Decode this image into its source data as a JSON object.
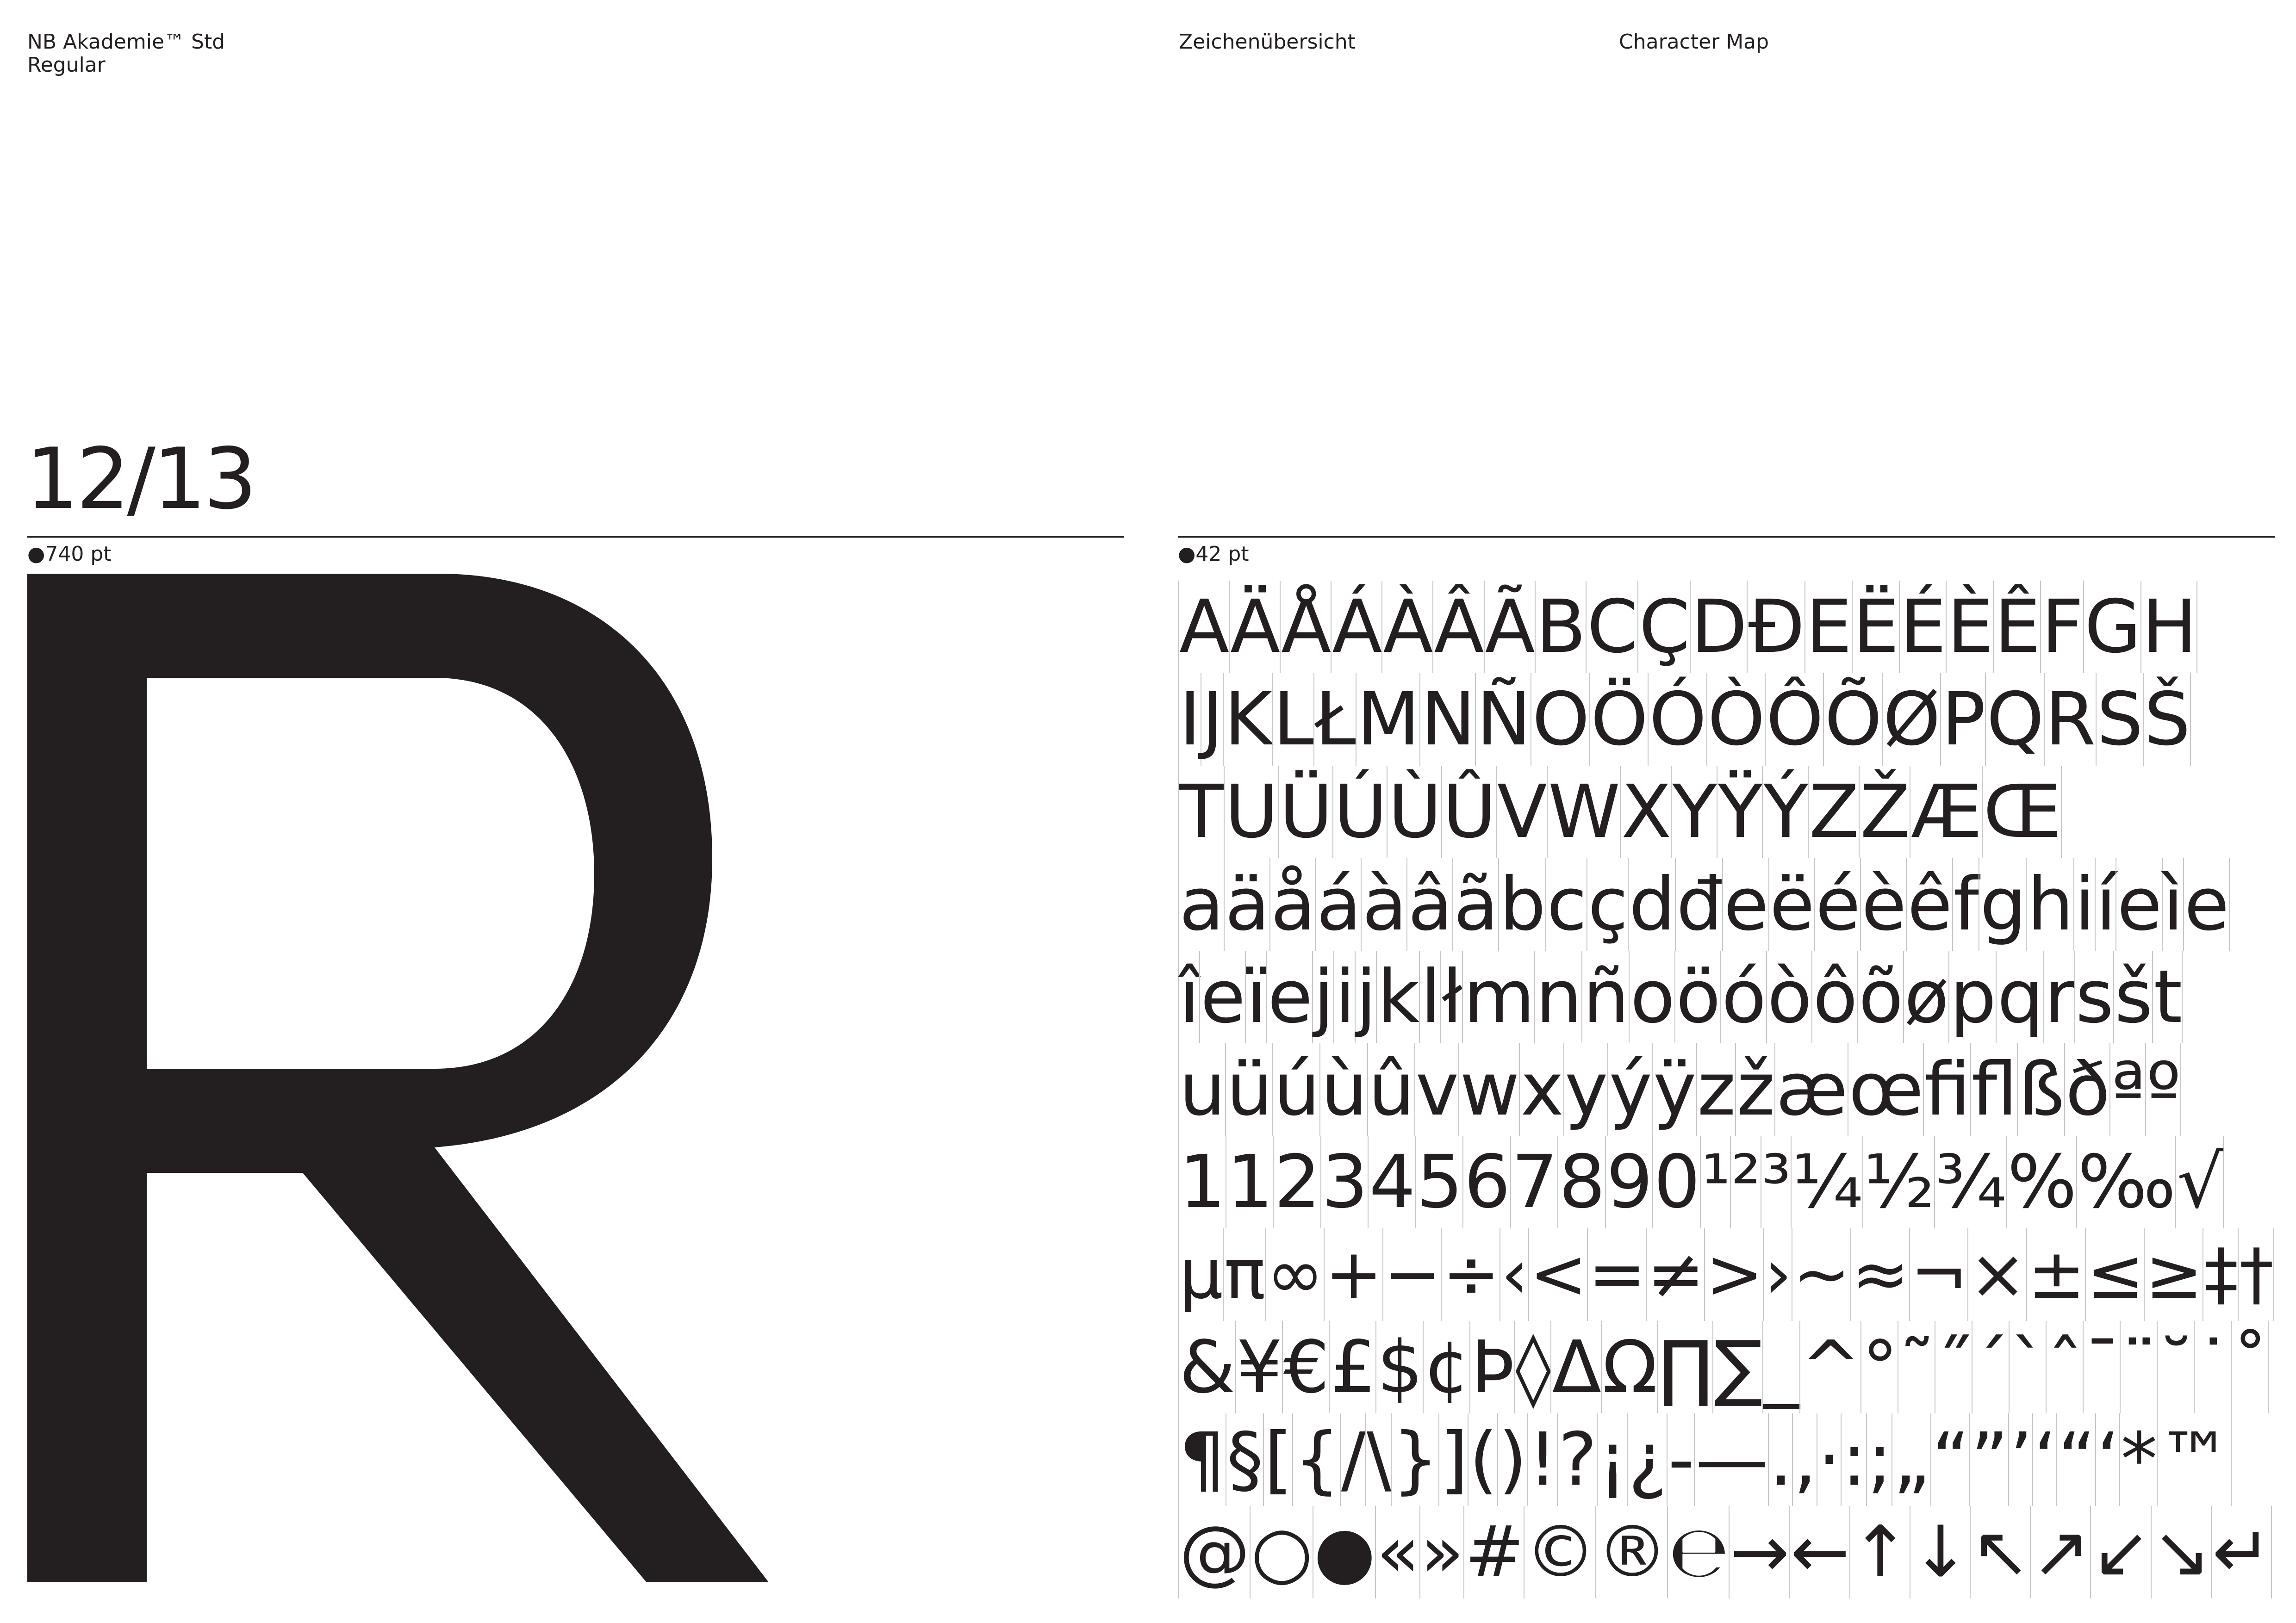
{
  "header": {
    "font_name": "NB Akademie™ Std\nRegular",
    "title_de": "Zeichenübersicht",
    "title_en": "Character Map"
  },
  "page_number": "12/13",
  "left_panel": {
    "size_label": "●740 pt",
    "glyph": "R"
  },
  "right_panel": {
    "size_label": "●42 pt",
    "rows": [
      [
        "A",
        "Ä",
        "Å",
        "Á",
        "À",
        "Â",
        "Ã",
        "B",
        "C",
        "Ç",
        "D",
        "Đ",
        "E",
        "Ë",
        "É",
        "È",
        "Ê",
        "F",
        "G",
        "H"
      ],
      [
        "I",
        "J",
        "K",
        "L",
        "Ł",
        "M",
        "N",
        "Ñ",
        "O",
        "Ö",
        "Ó",
        "Ò",
        "Ô",
        "Õ",
        "Ø",
        "P",
        "Q",
        "R",
        "S",
        "Š"
      ],
      [
        "T",
        "U",
        "Ü",
        "Ú",
        "Ù",
        "Û",
        "V",
        "W",
        "X",
        "Y",
        "Ÿ",
        "Ý",
        "Z",
        "Ž",
        "Æ",
        "Œ"
      ],
      [
        "a",
        "ä",
        "å",
        "á",
        "à",
        "â",
        "ã",
        "b",
        "c",
        "ç",
        "d",
        "đ",
        "e",
        "ë",
        "é",
        "è",
        "ê",
        "f",
        "g",
        "h",
        "i",
        "í",
        "e",
        "ì",
        "e"
      ],
      [
        "î",
        "e",
        "ï",
        "e",
        "j",
        "i",
        "j",
        "k",
        "l",
        "ł",
        "m",
        "n",
        "ñ",
        "o",
        "ö",
        "ó",
        "ò",
        "ô",
        "õ",
        "ø",
        "p",
        "q",
        "r",
        "s",
        "š",
        "t"
      ],
      [
        "u",
        "ü",
        "ú",
        "ù",
        "û",
        "v",
        "w",
        "x",
        "y",
        "ý",
        "ÿ",
        "z",
        "ž",
        "æ",
        "œ",
        "ﬁ",
        "ﬂ",
        "ß",
        "ð",
        "ª",
        "º"
      ],
      [
        "1",
        "1",
        "2",
        "3",
        "4",
        "5",
        "6",
        "7",
        "8",
        "9",
        "0",
        "¹",
        "²",
        "³",
        "¼",
        "½",
        "¾",
        "%",
        "‰",
        "√"
      ],
      [
        "µ",
        "π",
        "∞",
        "+",
        "−",
        "÷",
        "‹",
        "<",
        "=",
        "≠",
        ">",
        "›",
        "~",
        "≈",
        "¬",
        "×",
        "±",
        "≤",
        "≥",
        "‡",
        "†"
      ],
      [
        "&",
        "¥",
        "€",
        "£",
        "$",
        "¢",
        "Þ",
        "◊",
        "Δ",
        "Ω",
        "∏",
        "∑",
        "_",
        "^",
        "°",
        "˜",
        "˝",
        "ˊ",
        "ˋ",
        "ˆ",
        "¯",
        "¨",
        "˘",
        "˙",
        "˚"
      ],
      [
        "¶",
        "§",
        "[",
        "{",
        "/",
        "\\",
        "}",
        "]",
        "(",
        ")",
        "!",
        "?",
        "¡",
        "¿",
        "-",
        "—",
        ".",
        ",",
        "·",
        ":",
        ";",
        "„",
        "“",
        "”",
        "’",
        "‘",
        "“",
        "‘",
        "*",
        "™"
      ],
      [
        "@",
        "○",
        "●",
        "«",
        "»",
        "#",
        "©",
        "®",
        "℮",
        "→",
        "←",
        "↑",
        "↓",
        "↖",
        "↗",
        "↙",
        "↘",
        "↵"
      ]
    ]
  }
}
